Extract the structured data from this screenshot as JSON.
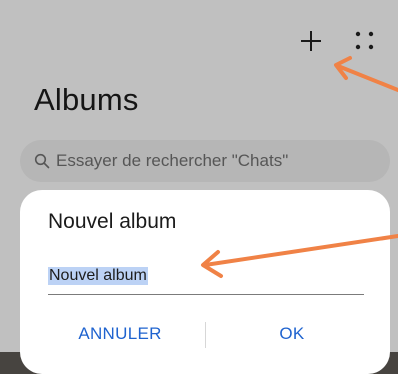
{
  "toolbar": {
    "add_icon": "plus-icon",
    "more_icon": "grid-dots-icon"
  },
  "page": {
    "title": "Albums"
  },
  "search": {
    "placeholder": "Essayer de rechercher \"Chats\"",
    "icon": "search-icon"
  },
  "dialog": {
    "title": "Nouvel album",
    "input_value": "Nouvel album",
    "cancel_label": "ANNULER",
    "ok_label": "OK"
  },
  "colors": {
    "accent": "#1f63cf",
    "annotation_arrow": "#f08246",
    "selection": "#bcd2f5"
  }
}
